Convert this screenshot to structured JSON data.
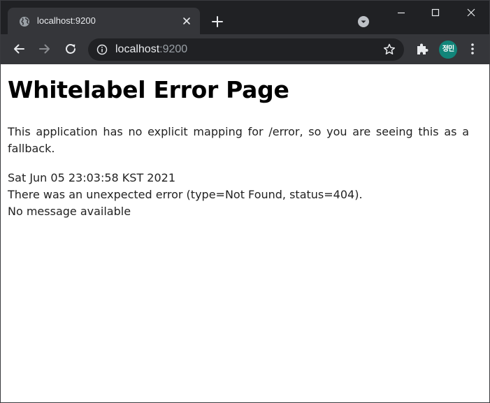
{
  "browser": {
    "tab": {
      "title": "localhost:9200"
    },
    "address_bar": {
      "host": "localhost",
      "port": ":9200"
    },
    "profile": {
      "initials": "정민",
      "color": "#12857a"
    },
    "icons": {
      "favicon": "globe-icon",
      "tab_close": "close-icon",
      "new_tab": "plus-icon",
      "tab_search": "chevron-down-icon",
      "back": "arrow-left-icon",
      "forward": "arrow-right-icon",
      "reload": "reload-icon",
      "site_info": "info-icon",
      "bookmark": "star-icon",
      "extensions": "puzzle-icon",
      "menu": "more-vertical-icon"
    }
  },
  "page": {
    "title": "Whitelabel Error Page",
    "explanation": "This application has no explicit mapping for /error, so you are seeing this as a fallback.",
    "timestamp": "Sat Jun 05 23:03:58 KST 2021",
    "error_line": "There was an unexpected error (type=Not Found, status=404).",
    "message": "No message available"
  }
}
